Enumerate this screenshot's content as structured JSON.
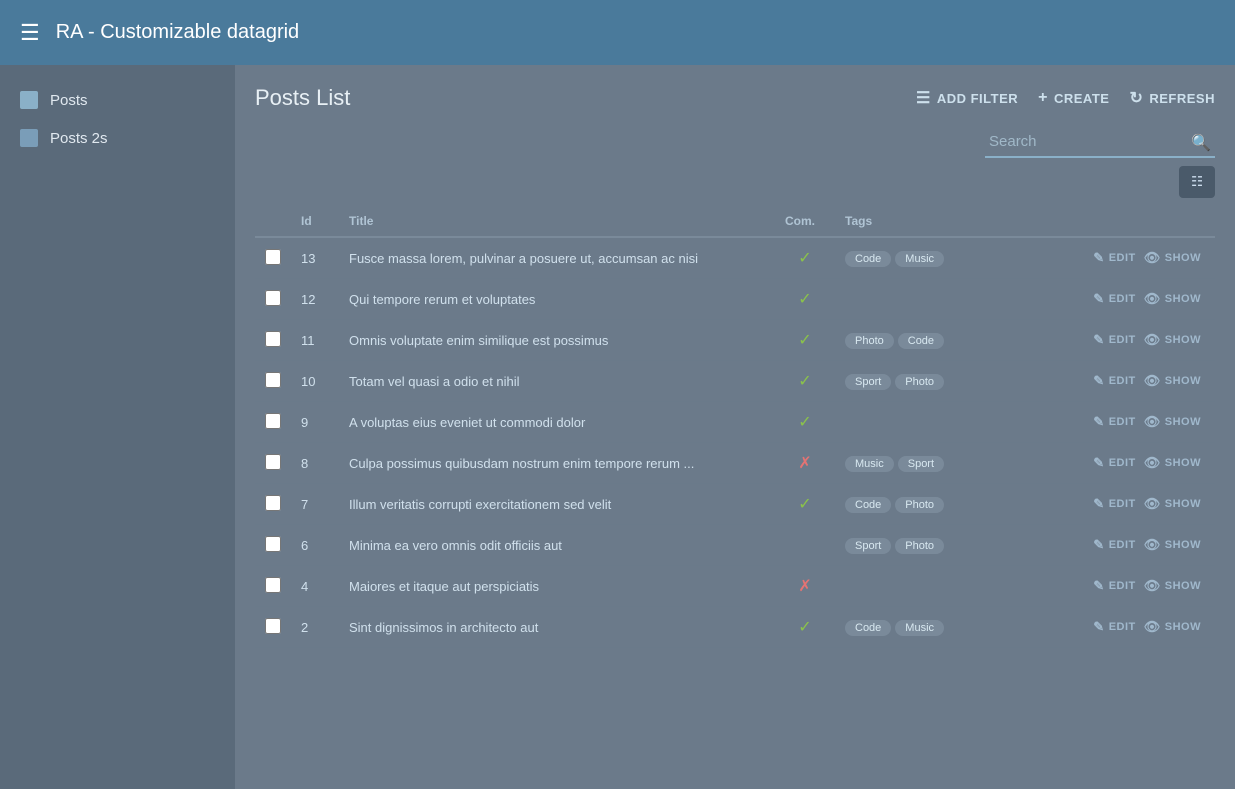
{
  "app": {
    "title": "RA - Customizable datagrid"
  },
  "sidebar": {
    "items": [
      {
        "id": "posts",
        "label": "Posts"
      },
      {
        "id": "posts2s",
        "label": "Posts 2s"
      }
    ]
  },
  "main": {
    "page_title": "Posts List",
    "toolbar": {
      "add_filter_label": "ADD FILTER",
      "create_label": "CREATE",
      "refresh_label": "REFRESH"
    },
    "search": {
      "placeholder": "Search"
    },
    "table": {
      "columns": [
        "",
        "Id",
        "Title",
        "Com.",
        "Tags",
        ""
      ],
      "rows": [
        {
          "id": 13,
          "title": "Fusce massa lorem, pulvinar a posuere ut, accumsan ac nisi",
          "comm": true,
          "tags": [
            "Code",
            "Music"
          ],
          "actions": [
            "EDIT",
            "SHOW"
          ]
        },
        {
          "id": 12,
          "title": "Qui tempore rerum et voluptates",
          "comm": true,
          "tags": [],
          "actions": [
            "EDIT",
            "SHOW"
          ]
        },
        {
          "id": 11,
          "title": "Omnis voluptate enim similique est possimus",
          "comm": true,
          "tags": [
            "Photo",
            "Code"
          ],
          "actions": [
            "EDIT",
            "SHOW"
          ]
        },
        {
          "id": 10,
          "title": "Totam vel quasi a odio et nihil",
          "comm": true,
          "tags": [
            "Sport",
            "Photo"
          ],
          "actions": [
            "EDIT",
            "SHOW"
          ]
        },
        {
          "id": 9,
          "title": "A voluptas eius eveniet ut commodi dolor",
          "comm": true,
          "tags": [],
          "actions": [
            "EDIT",
            "SHOW"
          ]
        },
        {
          "id": 8,
          "title": "Culpa possimus quibusdam nostrum enim tempore rerum ...",
          "comm": false,
          "tags": [
            "Music",
            "Sport"
          ],
          "actions": [
            "EDIT",
            "SHOW"
          ]
        },
        {
          "id": 7,
          "title": "Illum veritatis corrupti exercitationem sed velit",
          "comm": true,
          "tags": [
            "Code",
            "Photo"
          ],
          "actions": [
            "EDIT",
            "SHOW"
          ]
        },
        {
          "id": 6,
          "title": "Minima ea vero omnis odit officiis aut",
          "comm": null,
          "tags": [
            "Sport",
            "Photo"
          ],
          "actions": [
            "EDIT",
            "SHOW"
          ]
        },
        {
          "id": 4,
          "title": "Maiores et itaque aut perspiciatis",
          "comm": false,
          "tags": [],
          "actions": [
            "EDIT",
            "SHOW"
          ]
        },
        {
          "id": 2,
          "title": "Sint dignissimos in architecto aut",
          "comm": true,
          "tags": [
            "Code",
            "Music"
          ],
          "actions": [
            "EDIT",
            "SHOW"
          ]
        }
      ]
    }
  }
}
